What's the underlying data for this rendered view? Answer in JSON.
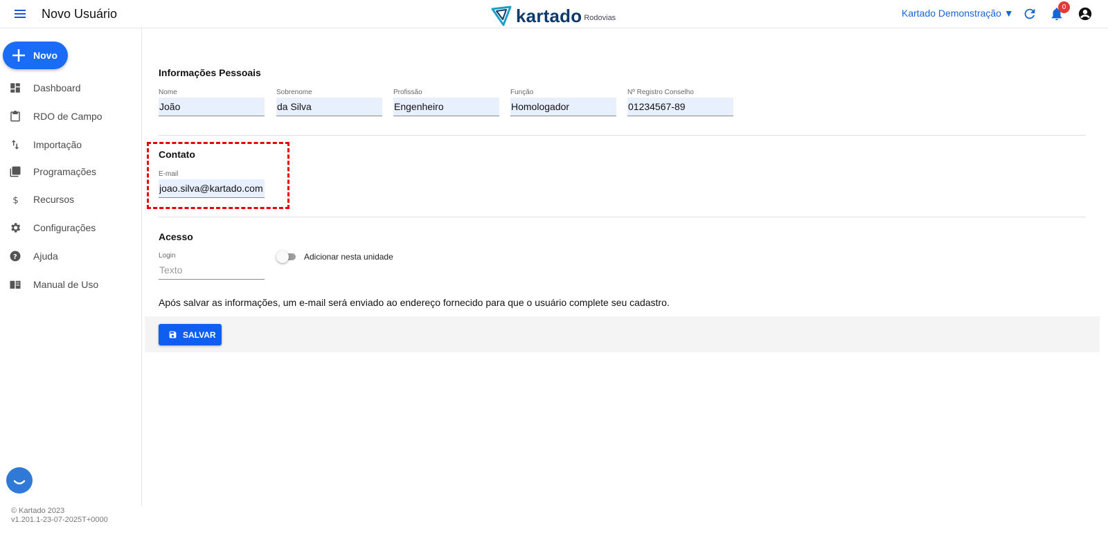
{
  "header": {
    "title": "Novo Usuário",
    "brand_name": "kartado",
    "brand_sub": "Rodovias",
    "account": "Kartado Demonstração ▼",
    "notification_count": "0"
  },
  "sidebar": {
    "new_label": "Novo",
    "items": [
      {
        "label": "Dashboard",
        "icon": "dashboard-icon"
      },
      {
        "label": "RDO de Campo",
        "icon": "clipboard-icon"
      },
      {
        "label": "Importação",
        "icon": "import-arrows-icon"
      },
      {
        "label": "Programações",
        "icon": "library-icon"
      },
      {
        "label": "Recursos",
        "icon": "dollar-icon"
      },
      {
        "label": "Configurações",
        "icon": "gear-icon"
      },
      {
        "label": "Ajuda",
        "icon": "help-icon"
      },
      {
        "label": "Manual de Uso",
        "icon": "book-icon"
      }
    ],
    "footer_line1": "© Kartado 2023",
    "footer_line2": "v1.201.1-23-07-2025T+0000"
  },
  "personal": {
    "title": "Informações Pessoais",
    "fields": [
      {
        "label": "Nome",
        "value": "João"
      },
      {
        "label": "Sobrenome",
        "value": "da Silva"
      },
      {
        "label": "Profissão",
        "value": "Engenheiro"
      },
      {
        "label": "Função",
        "value": "Homologador"
      },
      {
        "label": "Nº Registro Conselho",
        "value": "01234567-89"
      }
    ]
  },
  "contact": {
    "title": "Contato",
    "email_label": "E-mail",
    "email_value": "joao.silva@kartado.com.br"
  },
  "access": {
    "title": "Acesso",
    "login_label": "Login",
    "login_placeholder": "Texto",
    "toggle_label": "Adicionar nesta unidade",
    "toggle_on": false
  },
  "notice": "Após salvar as informações, um e-mail será enviado ao endereço fornecido para que o usuário complete seu cadastro.",
  "actions": {
    "save_label": "SALVAR"
  },
  "colors": {
    "accent": "#1a6bf5",
    "highlight": "#e60000",
    "badge": "#e53935"
  }
}
